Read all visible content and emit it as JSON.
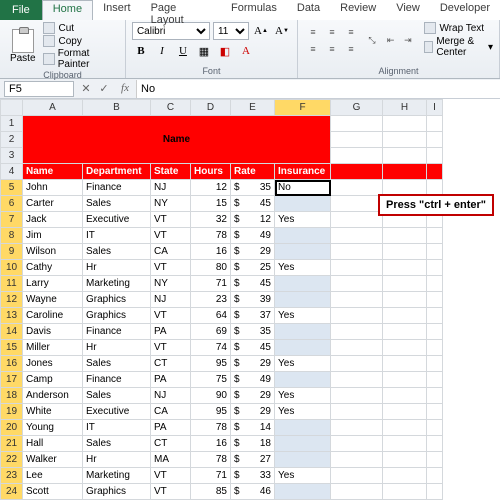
{
  "tabs": {
    "file": "File",
    "home": "Home",
    "insert": "Insert",
    "pagelayout": "Page Layout",
    "formulas": "Formulas",
    "data": "Data",
    "review": "Review",
    "view": "View",
    "developer": "Developer"
  },
  "ribbon": {
    "clipboard": {
      "paste": "Paste",
      "cut": "Cut",
      "copy": "Copy",
      "fmtpainter": "Format Painter",
      "group": "Clipboard"
    },
    "font": {
      "name": "Calibri",
      "size": "11",
      "group": "Font"
    },
    "align": {
      "wrap": "Wrap Text",
      "merge": "Merge & Center",
      "group": "Alignment"
    }
  },
  "namebox": "F5",
  "formula": "No",
  "columns": [
    "A",
    "B",
    "C",
    "D",
    "E",
    "F",
    "G",
    "H",
    "I"
  ],
  "merged_title": "Name",
  "headers": {
    "A": "Name",
    "B": "Department",
    "C": "State",
    "D": "Hours",
    "E": "Rate",
    "F": "Insurance"
  },
  "rows": [
    {
      "n": 5,
      "A": "John",
      "B": "Finance",
      "C": "NJ",
      "D": "12",
      "E": "35",
      "F": "No"
    },
    {
      "n": 6,
      "A": "Carter",
      "B": "Sales",
      "C": "NY",
      "D": "15",
      "E": "45",
      "F": ""
    },
    {
      "n": 7,
      "A": "Jack",
      "B": "Executive",
      "C": "VT",
      "D": "32",
      "E": "12",
      "F": "Yes"
    },
    {
      "n": 8,
      "A": "Jim",
      "B": "IT",
      "C": "VT",
      "D": "78",
      "E": "49",
      "F": ""
    },
    {
      "n": 9,
      "A": "Wilson",
      "B": "Sales",
      "C": "CA",
      "D": "16",
      "E": "29",
      "F": ""
    },
    {
      "n": 10,
      "A": "Cathy",
      "B": "Hr",
      "C": "VT",
      "D": "80",
      "E": "25",
      "F": "Yes"
    },
    {
      "n": 11,
      "A": "Larry",
      "B": "Marketing",
      "C": "NY",
      "D": "71",
      "E": "45",
      "F": ""
    },
    {
      "n": 12,
      "A": "Wayne",
      "B": "Graphics",
      "C": "NJ",
      "D": "23",
      "E": "39",
      "F": ""
    },
    {
      "n": 13,
      "A": "Caroline",
      "B": "Graphics",
      "C": "VT",
      "D": "64",
      "E": "37",
      "F": "Yes"
    },
    {
      "n": 14,
      "A": "Davis",
      "B": "Finance",
      "C": "PA",
      "D": "69",
      "E": "35",
      "F": ""
    },
    {
      "n": 15,
      "A": "Miller",
      "B": "Hr",
      "C": "VT",
      "D": "74",
      "E": "45",
      "F": ""
    },
    {
      "n": 16,
      "A": "Jones",
      "B": "Sales",
      "C": "CT",
      "D": "95",
      "E": "29",
      "F": "Yes"
    },
    {
      "n": 17,
      "A": "Camp",
      "B": "Finance",
      "C": "PA",
      "D": "75",
      "E": "49",
      "F": ""
    },
    {
      "n": 18,
      "A": "Anderson",
      "B": "Sales",
      "C": "NJ",
      "D": "90",
      "E": "29",
      "F": "Yes"
    },
    {
      "n": 19,
      "A": "White",
      "B": "Executive",
      "C": "CA",
      "D": "95",
      "E": "29",
      "F": "Yes"
    },
    {
      "n": 20,
      "A": "Young",
      "B": "IT",
      "C": "PA",
      "D": "78",
      "E": "14",
      "F": ""
    },
    {
      "n": 21,
      "A": "Hall",
      "B": "Sales",
      "C": "CT",
      "D": "16",
      "E": "18",
      "F": ""
    },
    {
      "n": 22,
      "A": "Walker",
      "B": "Hr",
      "C": "MA",
      "D": "78",
      "E": "27",
      "F": ""
    },
    {
      "n": 23,
      "A": "Lee",
      "B": "Marketing",
      "C": "VT",
      "D": "71",
      "E": "33",
      "F": "Yes"
    },
    {
      "n": 24,
      "A": "Scott",
      "B": "Graphics",
      "C": "VT",
      "D": "85",
      "E": "46",
      "F": ""
    }
  ],
  "callout": "Press \"ctrl + enter\"",
  "active_cell": "F5",
  "selected_column_F": true
}
